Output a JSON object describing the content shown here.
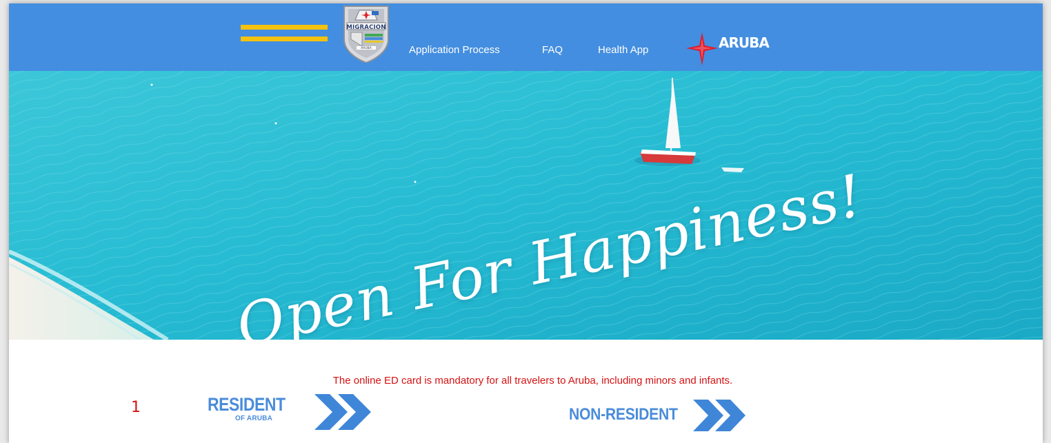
{
  "header": {
    "logo_text": "MIGRACION",
    "logo_subtext": "ARUBA",
    "nav_links": [
      "Application Process",
      "FAQ",
      "Health App"
    ],
    "brand_text": "ARUBA"
  },
  "hero": {
    "headline": "Open For Happiness!"
  },
  "notice": "The online ED card is mandatory for all travelers to Aruba, including minors and infants.",
  "annotation": "1",
  "cta": {
    "resident_label": "RESIDENT",
    "resident_sublabel": "OF ARUBA",
    "nonresident_label": "NON-RESIDENT"
  },
  "colors": {
    "nav_bg": "#438ee0",
    "menu_bar": "#f5c20f",
    "notice_red": "#d41111",
    "cta_blue": "#4a8cda",
    "sea": "#2cc2d6"
  },
  "icons": [
    "hamburger-menu-icon",
    "compass-star-icon",
    "chevron-double-right-icon"
  ]
}
